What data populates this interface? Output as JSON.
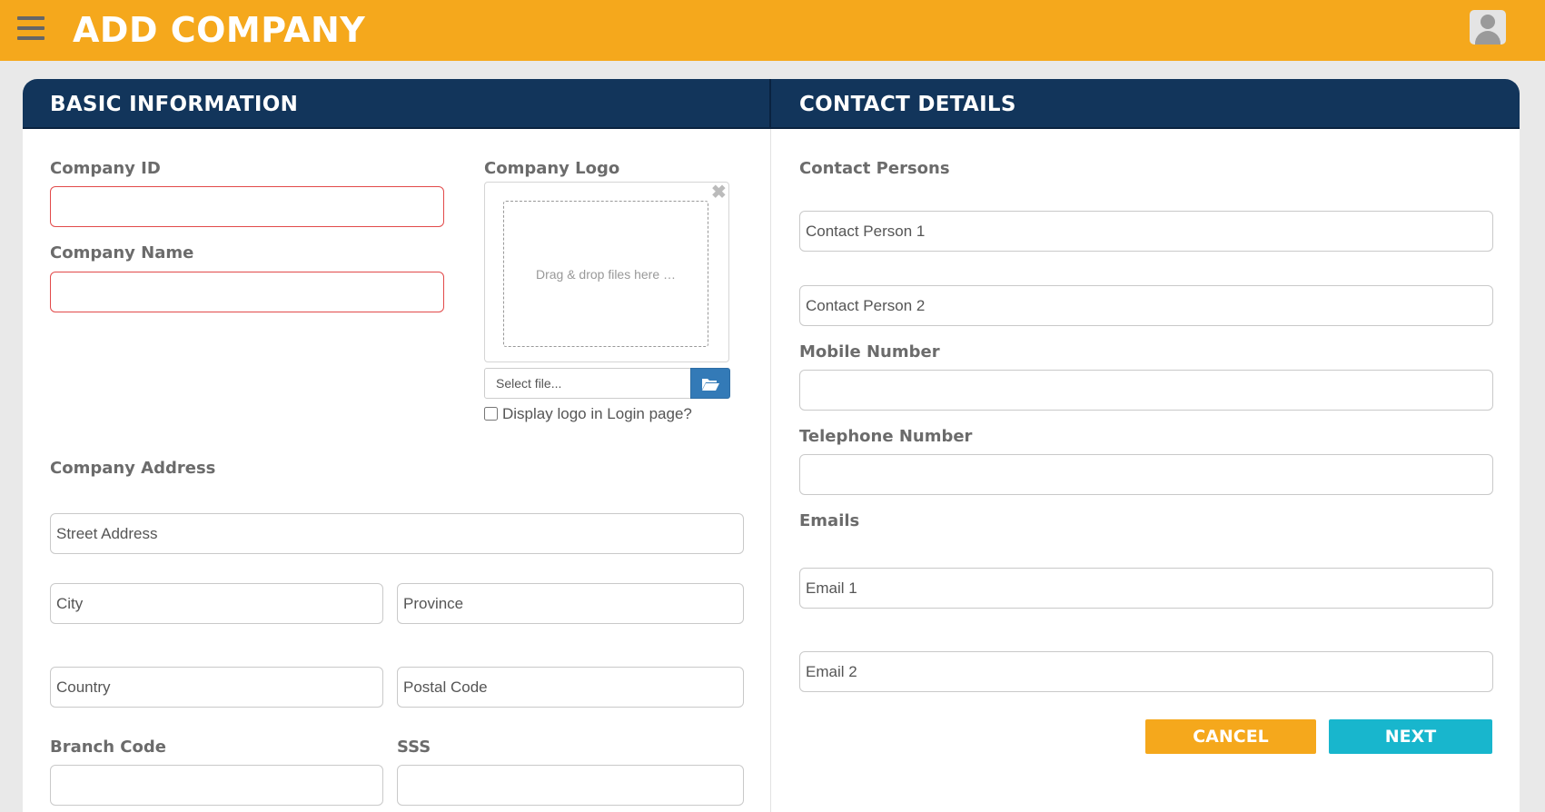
{
  "header": {
    "title": "ADD COMPANY",
    "menu_icon": "hamburger-menu-icon",
    "avatar_icon": "user-avatar-icon",
    "color": "#f5a81c"
  },
  "basic_info": {
    "title": "BASIC INFORMATION",
    "company_id_label": "Company ID",
    "company_name_label": "Company Name",
    "company_logo_label": "Company Logo",
    "drop_text": "Drag & drop files here …",
    "file_placeholder": "Select file...",
    "display_logo_label": "Display logo in Login page?",
    "address_label": "Company Address",
    "street_placeholder": "Street Address",
    "city_placeholder": "City",
    "province_placeholder": "Province",
    "country_placeholder": "Country",
    "postal_placeholder": "Postal Code",
    "branch_code_label": "Branch Code",
    "sss_label": "SSS"
  },
  "contact": {
    "title": "CONTACT DETAILS",
    "persons_label": "Contact Persons",
    "person1_placeholder": "Contact Person 1",
    "person2_placeholder": "Contact Person 2",
    "mobile_label": "Mobile Number",
    "telephone_label": "Telephone Number",
    "emails_label": "Emails",
    "email1_placeholder": "Email 1",
    "email2_placeholder": "Email 2"
  },
  "actions": {
    "cancel": "CANCEL",
    "next": "NEXT",
    "cancel_color": "#f5a81c",
    "next_color": "#18b6cd"
  },
  "colors": {
    "card_header": "#12355b",
    "required_border": "#e24a4a"
  }
}
